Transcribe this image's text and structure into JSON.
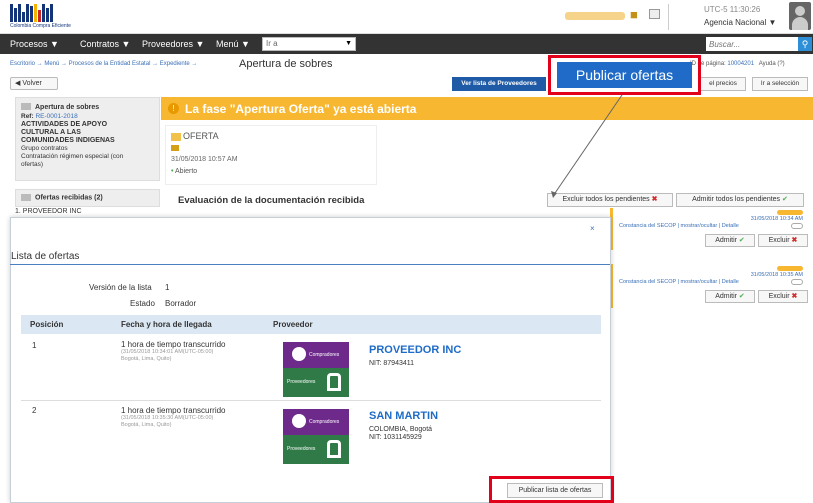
{
  "header": {
    "logo_text": "Colombia Compra Eficiente",
    "time_text": "UTC-5 11:30:26",
    "agency": "Agencia Nacional"
  },
  "nav": {
    "items": [
      "Procesos ▼",
      "Contratos ▼",
      "Proveedores ▼",
      "Menú ▼"
    ],
    "go_to_placeholder": "Ir a",
    "search_placeholder": "Buscar..."
  },
  "breadcrumb": "Escritorio → Menú → Procesos de la Entidad Estatal → Expediente →",
  "page_title": "Apertura de sobres",
  "page_id": {
    "label": "ID de página:",
    "value": "10004201",
    "help": "Ayuda (?)"
  },
  "toolbar": {
    "back": "Volver",
    "ver_lista": "Ver lista de Proveedores",
    "precios": "el precios",
    "ir_seleccion": "Ir a selección"
  },
  "callout_top_label": "Publicar ofertas",
  "left_panel": {
    "title": "Apertura de sobres",
    "ref_label": "Ref:",
    "ref_value": "RE-0001-2018",
    "activity": [
      "ACTIVIDADES DE APOYO",
      "CULTURAL A LAS",
      "COMUNIDADES INDIGENAS"
    ],
    "group": "Grupo contratos",
    "modality": [
      "Contratación régimen especial (con",
      "ofertas)"
    ],
    "ofertas_label": "Ofertas recibidas (2)",
    "first_provider": "1. PROVEEDOR INC"
  },
  "banner_text": "La fase \"Apertura Oferta\" ya está abierta",
  "oferta_card": {
    "title": "OFERTA",
    "date": "31/05/2018 10:57 AM",
    "state": "Abierto"
  },
  "evaluation": {
    "title": "Evaluación de la documentación recibida",
    "exclude_all": "Excluir todos los pendientes",
    "admit_all": "Admitir todos los pendientes"
  },
  "bg_rows": [
    {
      "date": "31/05/2018 10:34 AM",
      "link": "Constancia del SECOP | mostrar/ocultar | Detalle",
      "admit": "Admitir",
      "exclude": "Excluir"
    },
    {
      "date": "31/05/2018 10:35 AM",
      "link": "Constancia del SECOP | mostrar/ocultar | Detalle",
      "admit": "Admitir",
      "exclude": "Excluir"
    }
  ],
  "modal": {
    "close": "×",
    "title": "Lista de ofertas",
    "version_label": "Versión de la lista",
    "version_value": "1",
    "state_label": "Estado",
    "state_value": "Borrador",
    "columns": [
      "Posición",
      "Fecha y hora de llegada",
      "Proveedor"
    ],
    "rows": [
      {
        "position": "1",
        "time": "1 hora de tiempo transcurrido",
        "time_sub1": "(31/05/2018 10:34:01 AM(UTC-05:00)",
        "time_sub2": "Bogotá, Lima, Quito)",
        "provider": "PROVEEDOR INC",
        "lines": [
          "NIT: 87943411"
        ]
      },
      {
        "position": "2",
        "time": "1 hora de tiempo transcurrido",
        "time_sub1": "(31/05/2018 10:35:30 AM(UTC-05:00)",
        "time_sub2": "Bogotá, Lima, Quito)",
        "provider": "SAN MARTIN",
        "lines": [
          "COLOMBIA, Bogotá",
          "NIT: 1031145929"
        ]
      }
    ],
    "logo_top": "Compradores",
    "logo_bottom": "Proveedores",
    "publish_button": "Publicar lista de ofertas"
  },
  "colors": {
    "banner": "#f7b731",
    "callout": "#e3001b",
    "primary_blue": "#1f6bc7",
    "nav_bg": "#333333"
  }
}
